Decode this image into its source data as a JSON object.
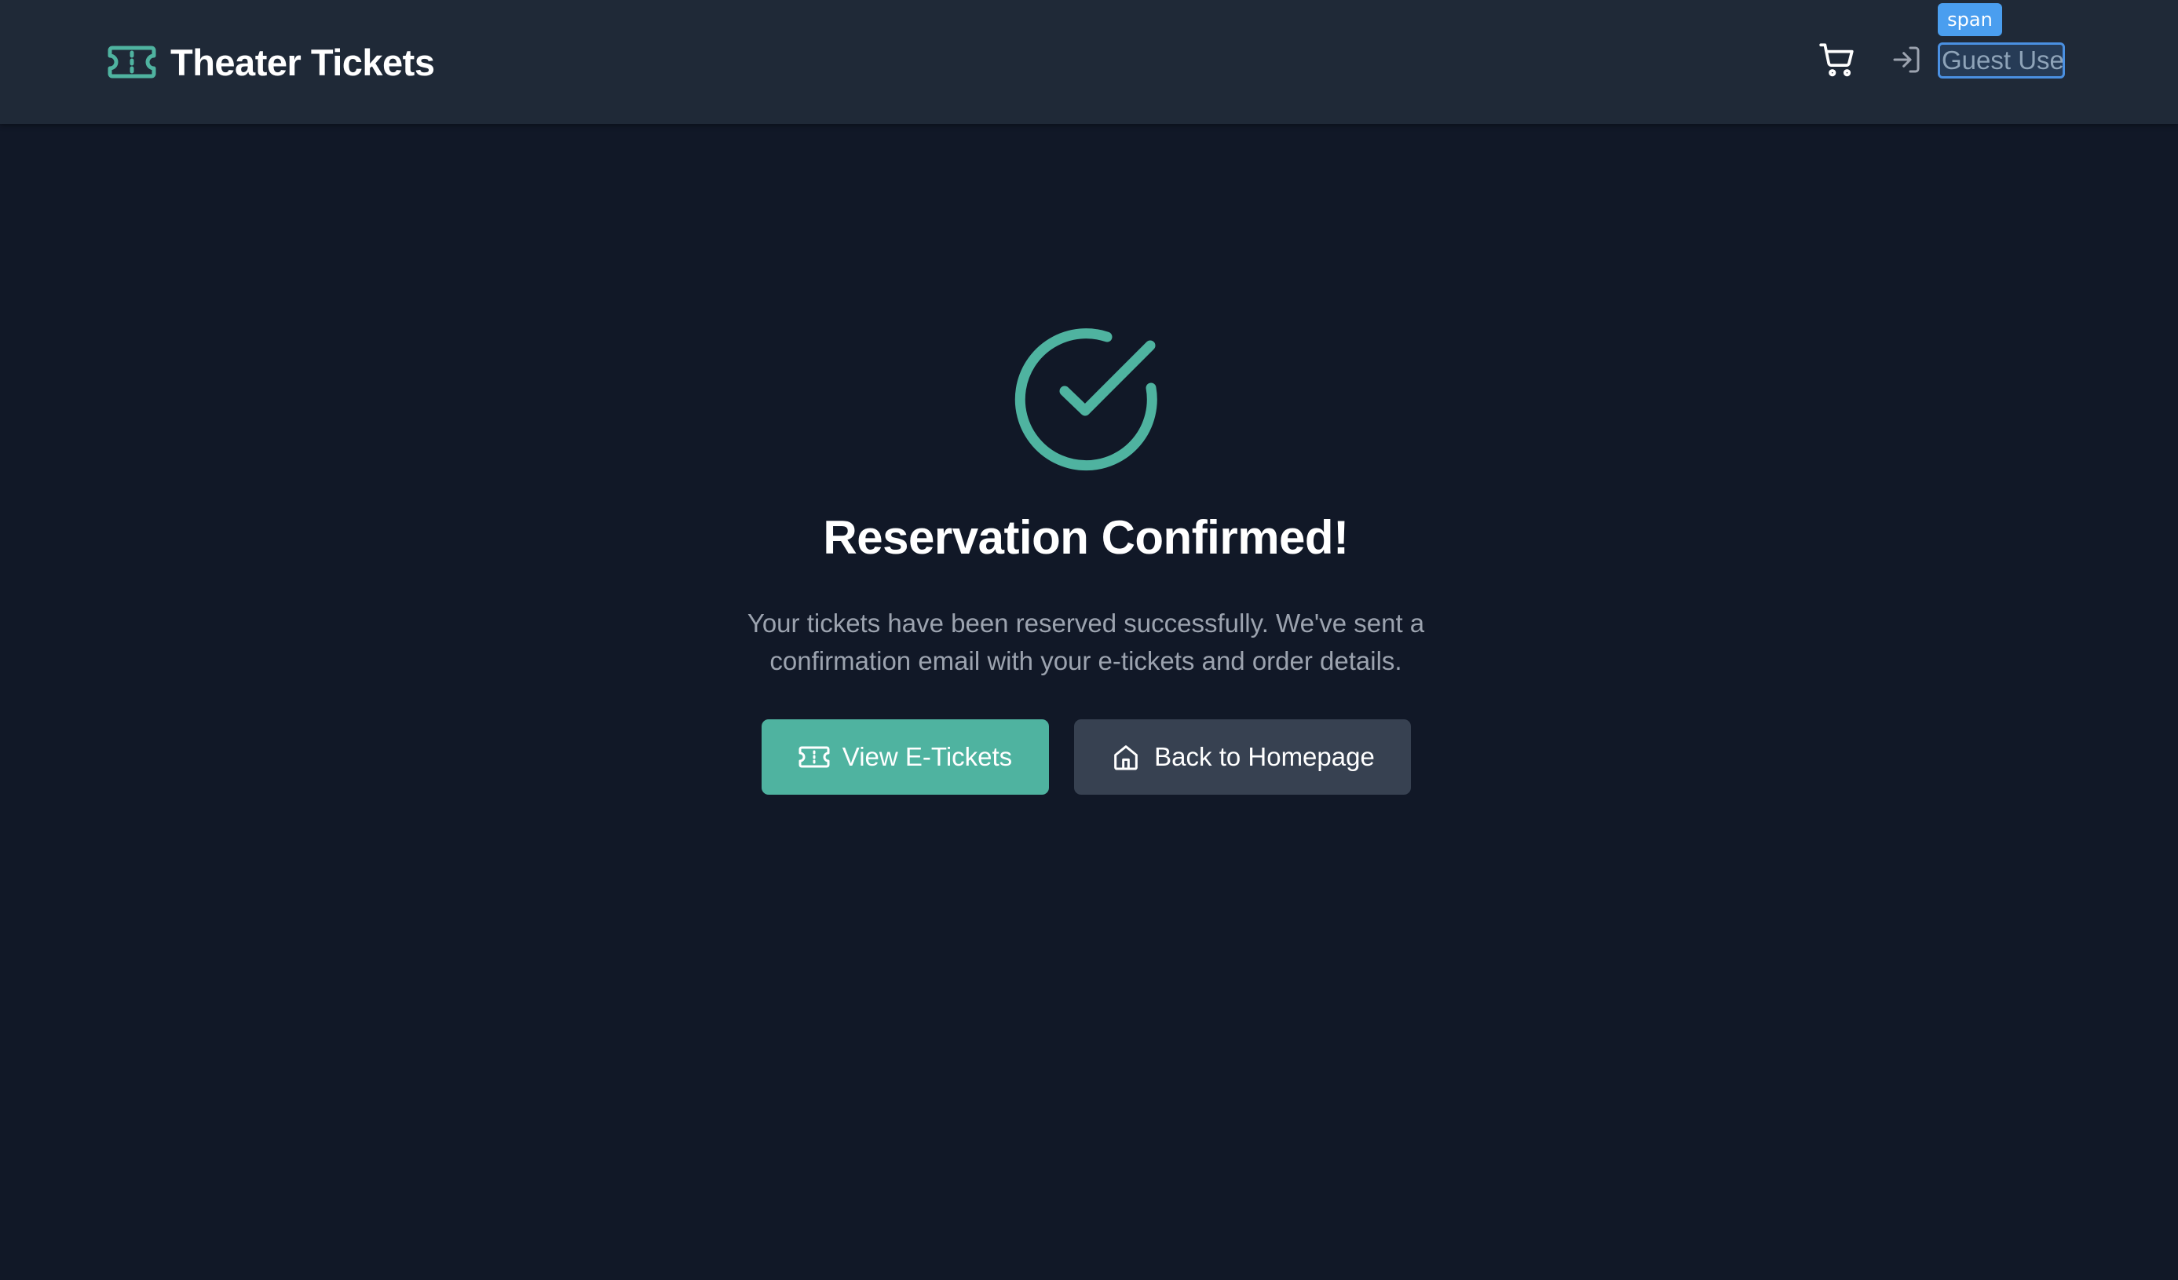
{
  "header": {
    "brand_title": "Theater Tickets",
    "brand_icon": "ticket-icon",
    "cart_icon": "shopping-cart-icon",
    "login_icon": "login-icon",
    "user_label": "Guest User",
    "inspector_tag": "span"
  },
  "confirmation": {
    "status_icon": "check-circle-icon",
    "title": "Reservation Confirmed!",
    "message": "Your tickets have been reserved successfully. We've sent a confirmation email with your e-tickets and order details.",
    "actions": {
      "view_tickets": {
        "label": "View E-Tickets",
        "icon": "ticket-icon"
      },
      "back_home": {
        "label": "Back to Homepage",
        "icon": "home-icon"
      }
    }
  },
  "colors": {
    "background": "#111827",
    "header_background": "#1f2937",
    "accent": "#4fb3a0",
    "secondary_button": "#374151",
    "muted_text": "#9ca3af",
    "highlight": "#4a90e2"
  }
}
